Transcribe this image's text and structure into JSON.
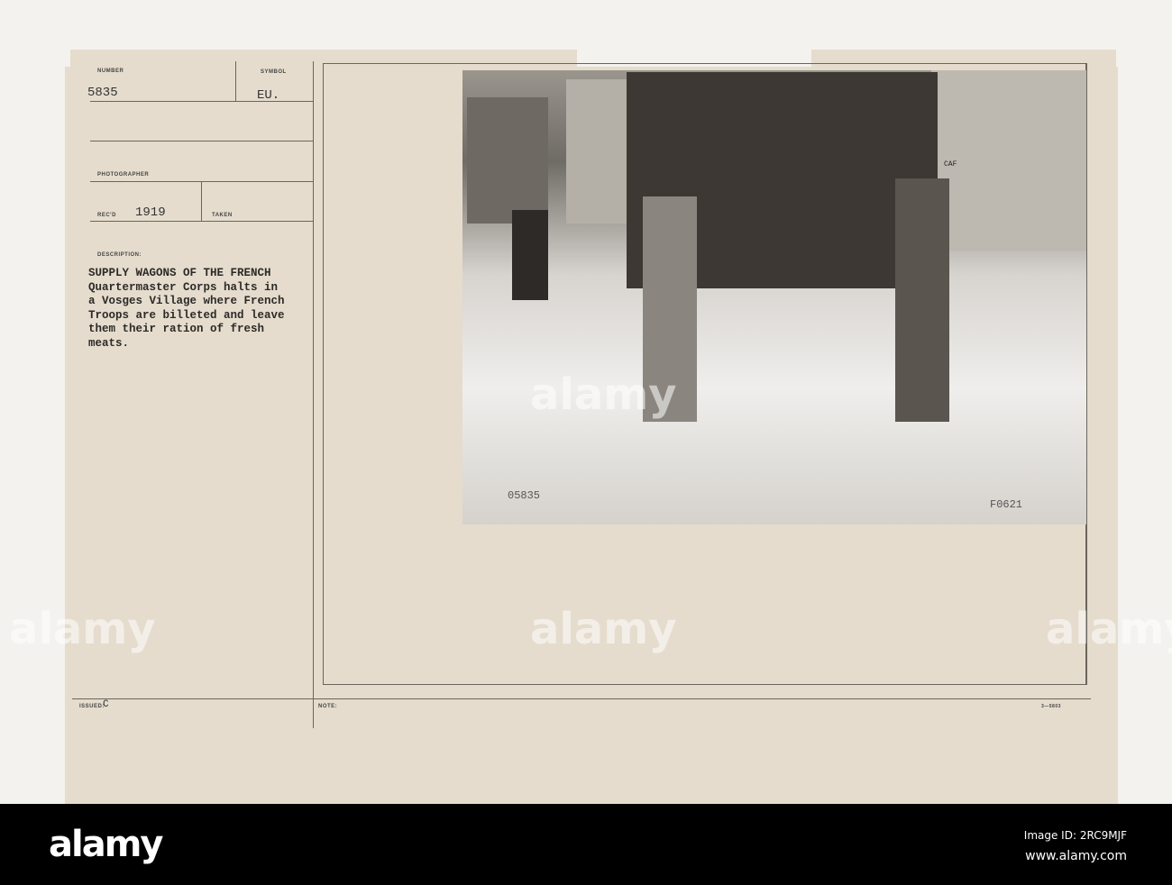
{
  "card": {
    "number_label": "NUMBER",
    "number": "5835",
    "symbol_label": "SYMBOL",
    "symbol": "EU.",
    "photographer_label": "PHOTOGRAPHER",
    "recd_label": "REC'D",
    "recd": "1919",
    "taken_label": "TAKEN",
    "description_label": "DESCRIPTION:",
    "description": "SUPPLY WAGONS OF THE FRENCH\nQuartermaster Corps halts in\na Vosges Village where French\nTroops are billeted and leave\nthem their ration of fresh\nmeats.",
    "issued_label": "ISSUED:",
    "issued": "C",
    "note_label": "NOTE:",
    "form_number": "3—5803"
  },
  "photo": {
    "negative_number": "05835",
    "corner_mark": "F0621",
    "sign_text": "CAF"
  },
  "watermark": {
    "text": "alamy"
  },
  "footer": {
    "logo": "alamy",
    "image_id": "Image ID: 2RC9MJF",
    "url": "www.alamy.com"
  }
}
